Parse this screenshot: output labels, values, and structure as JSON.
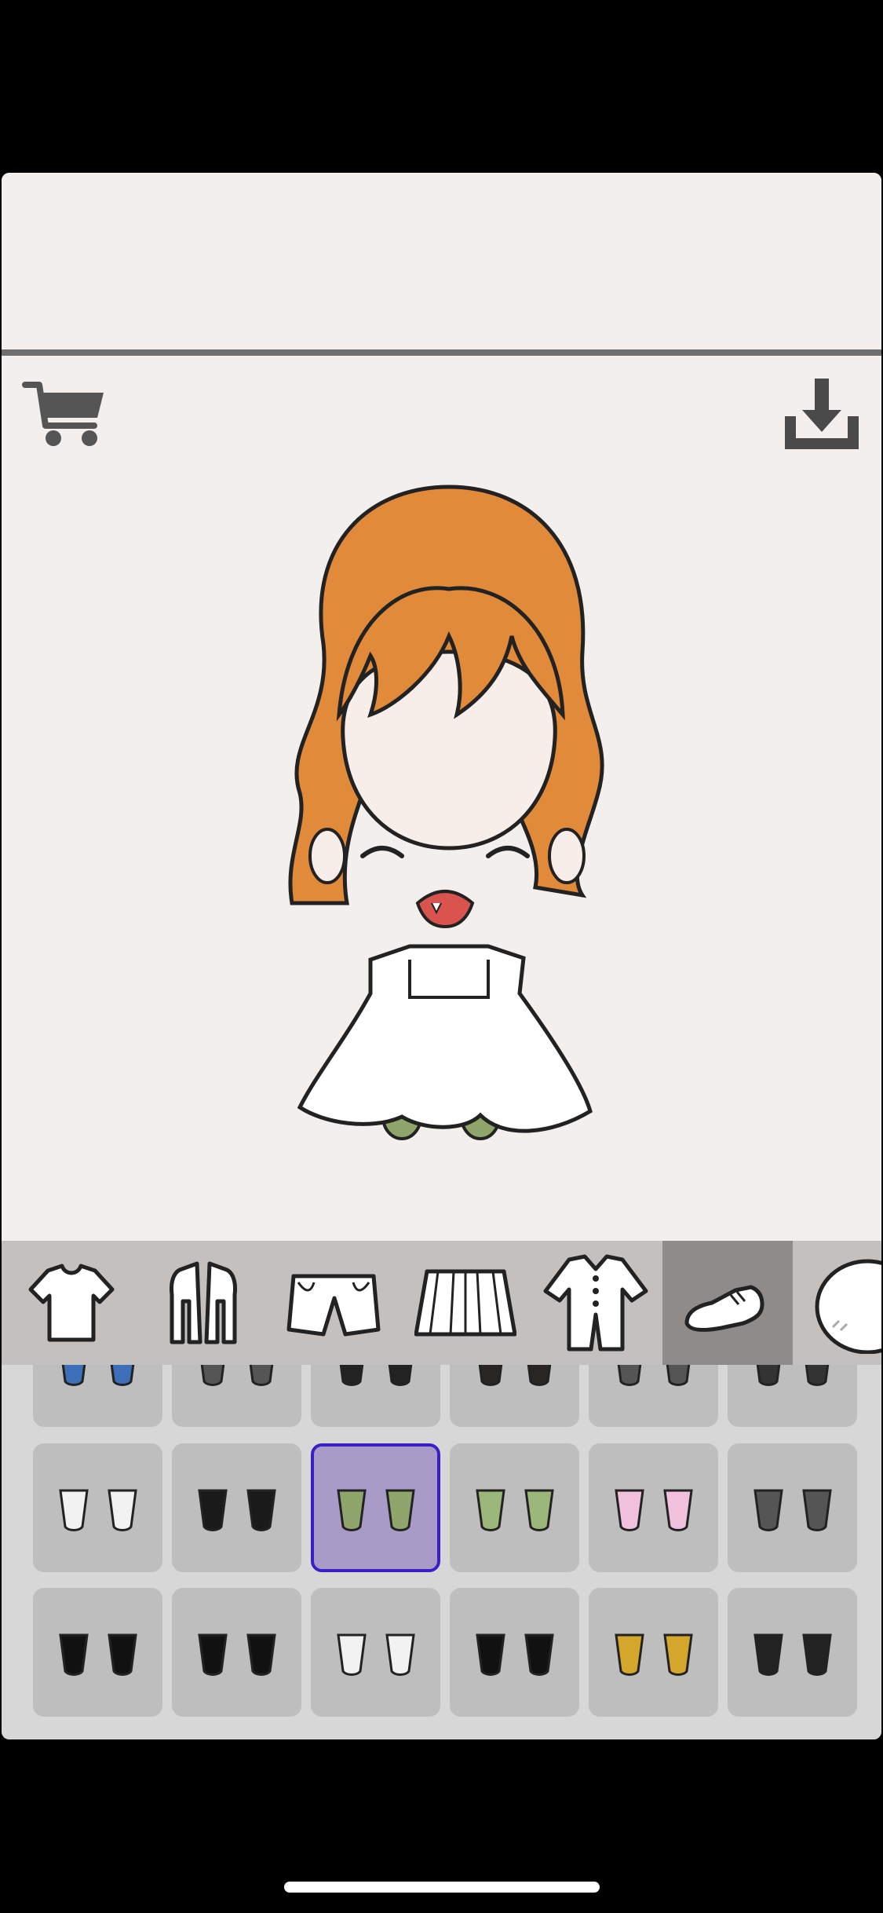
{
  "toolbar": {
    "cart_icon": "cart-icon",
    "download_icon": "download-icon"
  },
  "avatar": {
    "hair_color": "#e08a3a",
    "dress_color": "#ffffff",
    "stocking_color": "#8fa56b"
  },
  "categories": [
    {
      "icon": "tshirt-icon"
    },
    {
      "icon": "jacket-icon"
    },
    {
      "icon": "shorts-icon"
    },
    {
      "icon": "skirt-icon"
    },
    {
      "icon": "onesie-icon"
    },
    {
      "icon": "shoe-icon",
      "selected": true
    },
    {
      "icon": "head-icon"
    }
  ],
  "items": {
    "rows": [
      [
        {
          "color": "#3d6fb8"
        },
        {
          "color": "#555"
        },
        {
          "color": "#222"
        },
        {
          "color": "#2a2423"
        },
        {
          "color": "#555"
        },
        {
          "color": "#333"
        }
      ],
      [
        {
          "color": "#f2f2f2"
        },
        {
          "color": "#1a1a1a"
        },
        {
          "color": "#8fa56b",
          "selected": true
        },
        {
          "color": "#9bb77a"
        },
        {
          "color": "#f1c0dc"
        },
        {
          "color": "#555"
        }
      ],
      [
        {
          "color": "#111"
        },
        {
          "color": "#111"
        },
        {
          "color": "#f2f2f2"
        },
        {
          "color": "#111"
        },
        {
          "color": "#d4a72c"
        },
        {
          "color": "#222"
        }
      ]
    ]
  }
}
